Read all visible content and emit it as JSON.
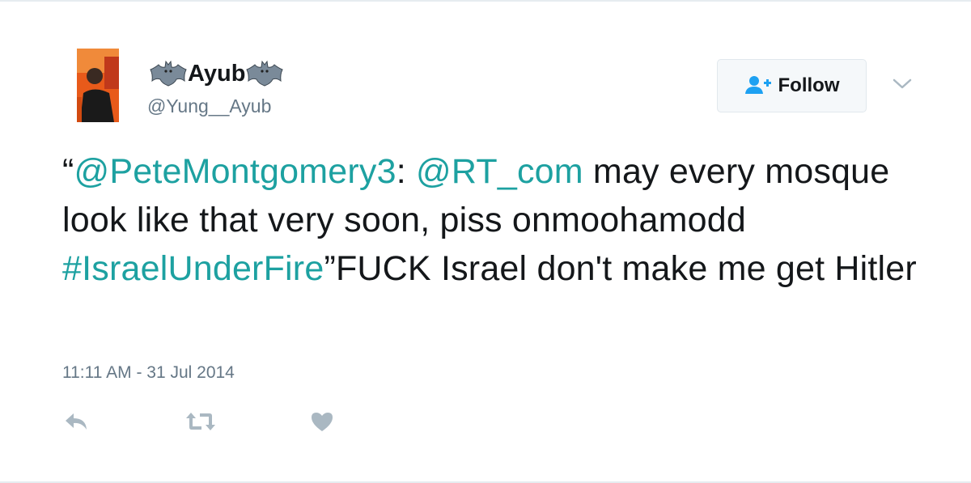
{
  "user": {
    "display_name": "Ayub",
    "screen_name": "@Yung__Ayub",
    "name_decoration_icon": "bat-icon",
    "avatar_icon": "avatar"
  },
  "follow_button": {
    "label": "Follow",
    "icon": "add-user-icon"
  },
  "menu_icon": "chevron-down-icon",
  "tweet": {
    "open_quote": "“",
    "mention1": "@PeteMontgomery3",
    "sep1": ": ",
    "mention2": "@RT_com",
    "text1": " may every mosque look like that very soon, piss onmoohamodd ",
    "hashtag": "#IsraelUnderFire",
    "text2": "”FUCK Israel don't make me get Hitler"
  },
  "timestamp": "11:11 AM - 31 Jul 2014",
  "actions": [
    "reply-icon",
    "retweet-icon",
    "like-icon"
  ],
  "colors": {
    "link": "#1da1a1",
    "text": "#14171a",
    "muted": "#657786",
    "action_icon": "#aab8c2",
    "follow_icon": "#1da1f2"
  }
}
